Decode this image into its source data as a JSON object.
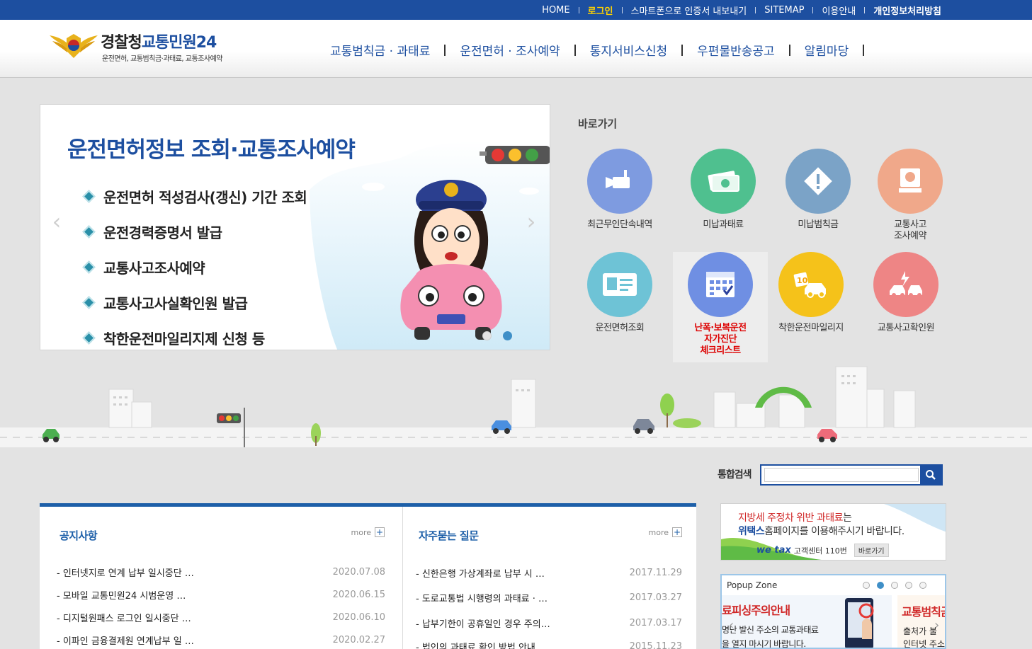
{
  "topbar": {
    "items": [
      {
        "label": "HOME"
      },
      {
        "label": "로그인"
      },
      {
        "label": "스마트폰으로 인증서 내보내기"
      },
      {
        "label": "SITEMAP"
      },
      {
        "label": "이용안내"
      },
      {
        "label": "개인정보처리방침"
      }
    ]
  },
  "logo": {
    "main_prefix": "경찰청",
    "main_suffix": "교통민원24",
    "sub": "운전면허, 교통범칙금·과태료, 교통조사예약"
  },
  "gnb": {
    "items": [
      {
        "label": "교통범칙금 · 과태료"
      },
      {
        "label": "운전면허 · 조사예약"
      },
      {
        "label": "통지서비스신청"
      },
      {
        "label": "우편물반송공고"
      },
      {
        "label": "알림마당"
      }
    ]
  },
  "banner": {
    "title": "운전면허정보 조회·교통조사예약",
    "items": [
      "운전면허 적성검사(갱신) 기간 조회",
      "운전경력증명서 발급",
      "교통사고조사예약",
      "교통사고사실확인원 발급",
      "착한운전마일리지제 신청 등"
    ],
    "prev": "‹",
    "next": "›"
  },
  "quick": {
    "title": "바로가기",
    "items": [
      {
        "label": "최근무인단속내역",
        "icon": "camera-icon",
        "color": "#7e9be0"
      },
      {
        "label": "미납과태료",
        "icon": "money-icon",
        "color": "#4fc08f"
      },
      {
        "label": "미납범칙금",
        "icon": "warning-icon",
        "color": "#7ba3c7"
      },
      {
        "label": "교통사고\n조사예약",
        "icon": "reservation-icon",
        "color": "#f0a88a"
      },
      {
        "label": "운전면허조회",
        "icon": "license-card-icon",
        "color": "#6ec3d6"
      },
      {
        "label": "난폭·보복운전\n자가진단\n체크리스트",
        "icon": "calendar-check-icon",
        "color": "#6f8fe3"
      },
      {
        "label": "착한운전마일리지",
        "icon": "mileage-car-icon",
        "color": "#f5c21a"
      },
      {
        "label": "교통사고확인원",
        "icon": "crash-icon",
        "color": "#ee8585"
      }
    ]
  },
  "search": {
    "label": "통합검색",
    "value": "",
    "placeholder": ""
  },
  "notice": {
    "title": "공지사항",
    "more": "more",
    "items": [
      {
        "title": "인터넷지로 연계 납부 일시중단 …",
        "date": "2020.07.08"
      },
      {
        "title": "모바일 교통민원24 시범운영 …",
        "date": "2020.06.15"
      },
      {
        "title": "디지털원패스 로그인 일시중단 …",
        "date": "2020.06.10"
      },
      {
        "title": "이파인 금융결제원 연계납부 일 …",
        "date": "2020.02.27"
      }
    ]
  },
  "faq": {
    "title": "자주묻는 질문",
    "more": "more",
    "items": [
      {
        "title": "신한은행 가상계좌로 납부 시 …",
        "date": "2017.11.29"
      },
      {
        "title": "도로교통법 시행령의 과태료 · …",
        "date": "2017.03.27"
      },
      {
        "title": "납부기한이 공휴일인 경우 주의…",
        "date": "2017.03.17"
      },
      {
        "title": "법인의 과태료 확인 방법 안내",
        "date": "2015.11.23"
      }
    ]
  },
  "wetax": {
    "line1_red": "지방세 주정차 위반 과태료",
    "line1_rest": "는",
    "line2_bold": "위택스",
    "line2_rest": "홈페이지를 이용해주시기 바랍니다.",
    "logo": "we tax",
    "center": "고객센터 110번",
    "go": "바로가기"
  },
  "popup": {
    "title": "Popup Zone",
    "slide1_title": "료피싱주의안내",
    "slide1_l1": "명난 발신 주소의 교통과태료",
    "slide1_l2": "을 열지 마시기 바랍니다.",
    "slide2_title": "교통범칙금",
    "slide2_l1": "출처가 불",
    "slide2_l2": "인터넷 주소"
  }
}
